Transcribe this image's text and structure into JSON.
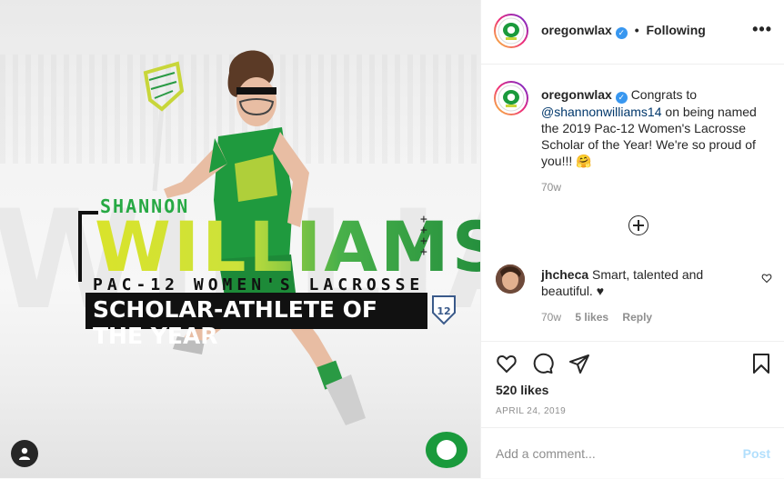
{
  "image": {
    "bg_word": "WILLIAMS",
    "name_top": "SHANNON",
    "name_main": "WILLIAMS",
    "subtitle": "PAC-12 WOMEN'S LACROSSE",
    "award": "SCHOLAR-ATHLETE OF THE YEAR",
    "brand_green": "#1f8a3b",
    "accent_yellow": "#d9e32b",
    "user_tag_icon": "user-icon"
  },
  "header": {
    "username": "oregonwlax",
    "follow_separator": "•",
    "follow_label": "Following",
    "more_icon": "more-horizontal-icon"
  },
  "caption": {
    "username": "oregonwlax",
    "text_before": "Congrats to ",
    "mention": "@shannonwilliams14",
    "text_after": " on being named the 2019 Pac-12 Women's Lacrosse Scholar of the Year! We're so proud of you!!! 🤗",
    "time": "70w"
  },
  "load_more_icon": "plus-circle-icon",
  "comments": [
    {
      "username": "jhcheca",
      "text": "Smart, talented and beautiful. ♥",
      "time": "70w",
      "likes": "5 likes",
      "reply": "Reply"
    }
  ],
  "actions": {
    "like_icon": "heart-icon",
    "comment_icon": "comment-icon",
    "share_icon": "share-icon",
    "save_icon": "bookmark-icon"
  },
  "likes": "520 likes",
  "date": "APRIL 24, 2019",
  "add_comment": {
    "placeholder": "Add a comment...",
    "post_label": "Post"
  },
  "colors": {
    "link": "#00376b",
    "verified": "#3897f0",
    "muted": "#8e8e8e",
    "post_disabled": "#b2dffc"
  }
}
